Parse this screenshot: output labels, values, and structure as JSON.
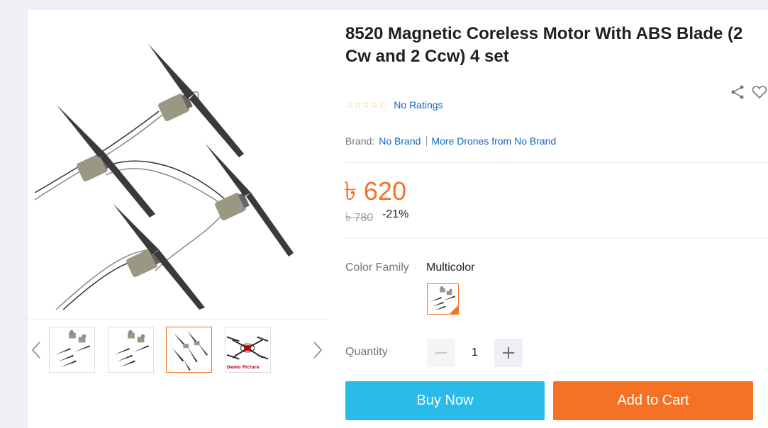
{
  "product": {
    "title": "8520 Magnetic Coreless Motor With ABS Blade (2 Cw and 2 Ccw) 4 set",
    "stars": "☆☆☆☆☆",
    "ratings_text": "No Ratings",
    "brand_label": "Brand:",
    "brand_name": "No Brand",
    "more_from_brand": "More Drones from No Brand",
    "price": "৳ 620",
    "original_price": "৳ 780",
    "discount": "-21%"
  },
  "variant": {
    "color_label": "Color Family",
    "color_value": "Multicolor"
  },
  "quantity": {
    "label": "Quantity",
    "value": "1",
    "minus": "−",
    "plus": "+"
  },
  "actions": {
    "buy_now": "Buy Now",
    "add_to_cart": "Add to Cart"
  },
  "gallery": {
    "demo_label": "Demo Picture",
    "active_index": 3
  },
  "icons": {
    "share": "share-icon",
    "wishlist": "heart-icon",
    "prev": "chevron-left-icon",
    "next": "chevron-right-icon"
  },
  "colors": {
    "accent": "#f57224",
    "buy_now": "#2abbe8",
    "link": "#1565c0",
    "background": "#eff0f5"
  }
}
